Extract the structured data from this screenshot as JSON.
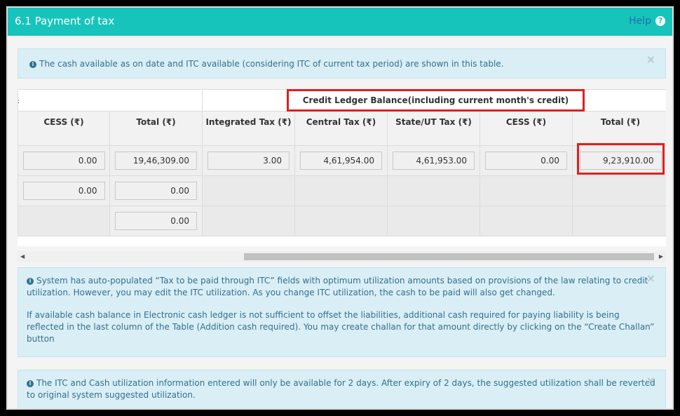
{
  "header": {
    "title": "6.1 Payment of tax",
    "help_label": "Help",
    "help_icon": "?"
  },
  "notice_top": "The cash available as on date and ITC available (considering ITC of current tax period) are shown in this table.",
  "table": {
    "credit_banner": "Credit Ledger Balance(including current month's credit)",
    "headers": [
      "CESS (₹)",
      "Total (₹)",
      "Integrated Tax (₹)",
      "Central Tax (₹)",
      "State/UT Tax (₹)",
      "CESS (₹)",
      "Total (₹)"
    ],
    "row1": [
      "0.00",
      "19,46,309.00",
      "3.00",
      "4,61,954.00",
      "4,61,953.00",
      "0.00",
      "9,23,910.00"
    ],
    "row2": [
      "0.00",
      "0.00"
    ],
    "row3": [
      "0.00"
    ]
  },
  "notice_mid": {
    "para1": "System has auto-populated “Tax to be paid through ITC” fields with optimum utilization amounts based on provisions of the law relating to credit utilization. However, you may edit the ITC utilization. As you change ITC utilization, the cash to be paid will also get changed.",
    "para2": "If available cash balance in Electronic cash ledger is not sufficient to offset the liabilities, additional cash required for paying liability is being reflected in the last column of the Table (Addition cash required). You may create challan for that amount directly by clicking on the “Create Challan” button"
  },
  "notice_bottom": "The ITC and Cash utilization information entered will only be available for 2 days. After expiry of 2 days, the suggested utilization shall be reverted to original system suggested utilization.",
  "colors": {
    "header_bg": "#17c4bb",
    "alert_bg": "#daeef6",
    "highlight": "#e02020"
  }
}
